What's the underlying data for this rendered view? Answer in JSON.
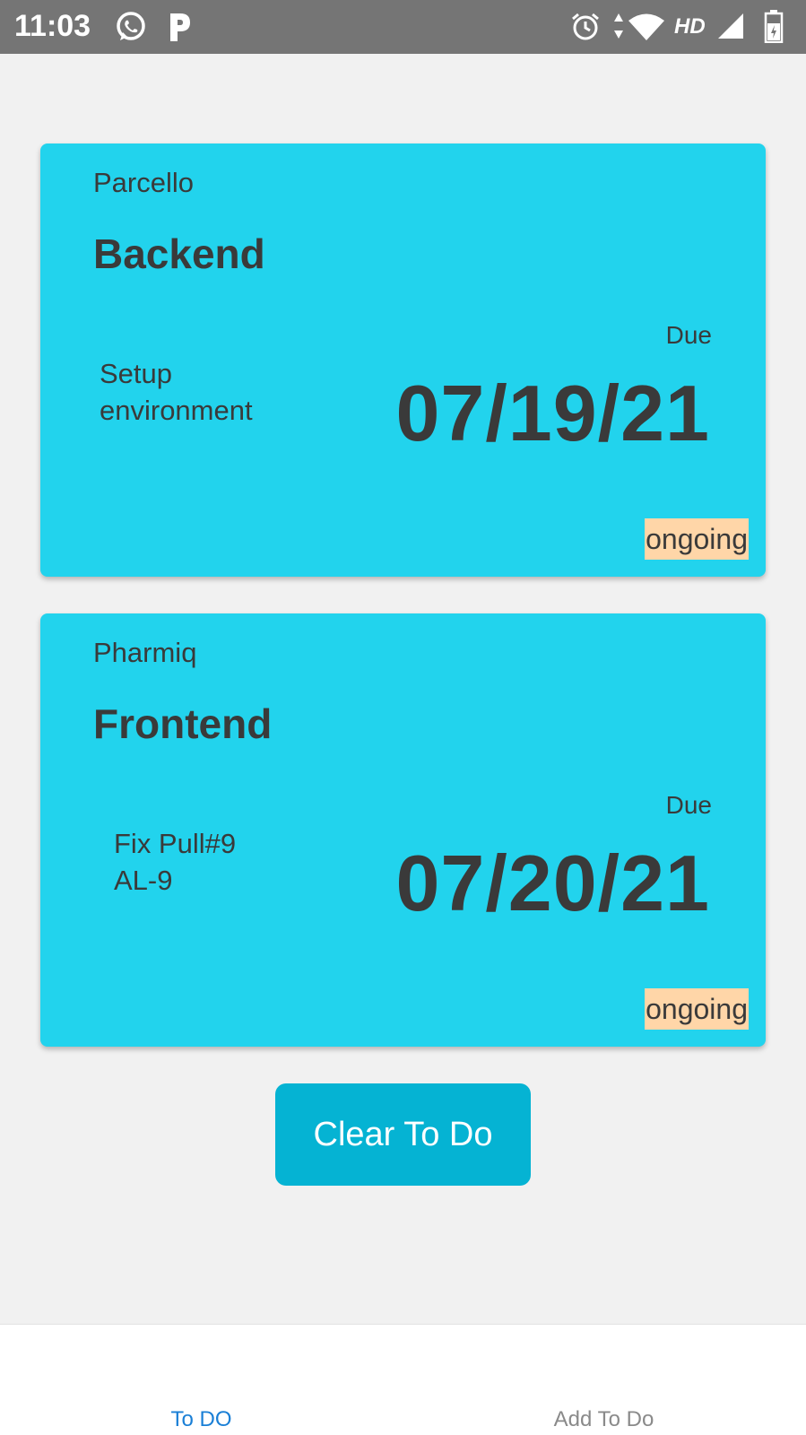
{
  "status_bar": {
    "time": "11:03",
    "network": "HD"
  },
  "todos": [
    {
      "project": "Parcello",
      "title": "Backend",
      "description_lines": [
        "Setup",
        "environment"
      ],
      "due_label": "Due",
      "due_date": "07/19/21",
      "status": "ongoing"
    },
    {
      "project": "Pharmiq",
      "title": "Frontend",
      "description_lines": [
        "Fix Pull#9",
        "AL-9"
      ],
      "due_label": "Due",
      "due_date": "07/20/21",
      "status": "ongoing"
    }
  ],
  "clear_button_label": "Clear To Do",
  "bottom_nav": {
    "tabs": [
      {
        "label": "To DO",
        "active": true
      },
      {
        "label": "Add To Do",
        "active": false
      }
    ]
  },
  "colors": {
    "card": "#22d3ed",
    "button": "#05b3d3",
    "status_badge": "#ffd6a8",
    "active_tab": "#1a7fd6"
  }
}
